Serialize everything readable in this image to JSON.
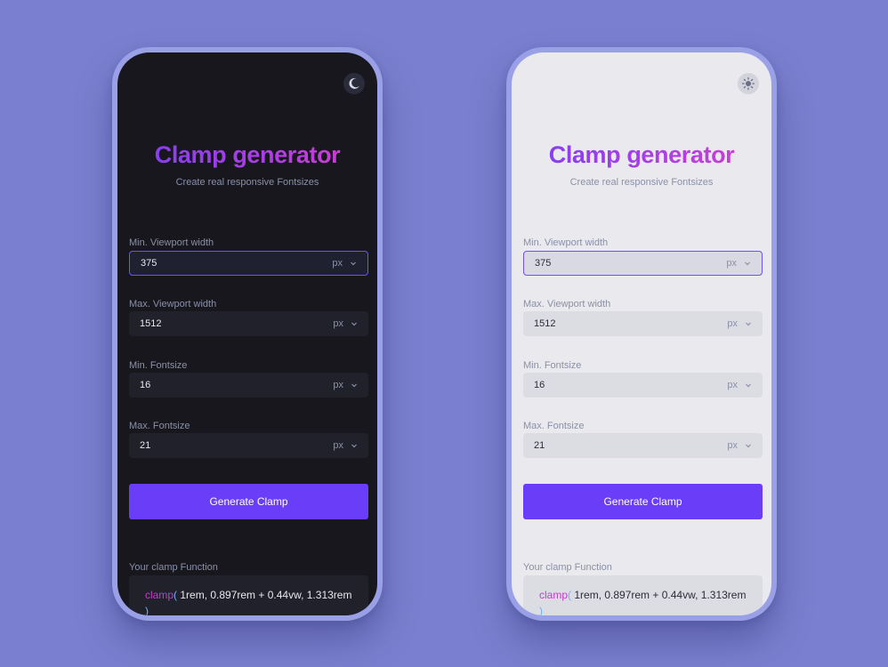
{
  "colors": {
    "background": "#7a7fcf",
    "accent": "#6a3df8",
    "title_gradient_start": "#7b3ff2",
    "title_gradient_end": "#d53ec9",
    "function_keyword": "#c23ec7",
    "parenthesis": "#6fb0ff"
  },
  "dark": {
    "theme_icon": "moon-icon",
    "title": "Clamp generator",
    "subtitle": "Create real responsive Fontsizes",
    "fields": [
      {
        "label": "Min. Viewport width",
        "value": "375",
        "unit": "px"
      },
      {
        "label": "Max. Viewport width",
        "value": "1512",
        "unit": "px"
      },
      {
        "label": "Min. Fontsize",
        "value": "16",
        "unit": "px"
      },
      {
        "label": "Max. Fontsize",
        "value": "21",
        "unit": "px"
      }
    ],
    "generate_label": "Generate Clamp",
    "result_label": "Your clamp Function",
    "result": {
      "fn": "clamp",
      "open": "(",
      "args": " 1rem, 0.897rem + 0.44vw, 1.313rem ",
      "close": ")"
    }
  },
  "light": {
    "theme_icon": "sun-icon",
    "title": "Clamp generator",
    "subtitle": "Create real responsive Fontsizes",
    "fields": [
      {
        "label": "Min. Viewport width",
        "value": "375",
        "unit": "px"
      },
      {
        "label": "Max. Viewport width",
        "value": "1512",
        "unit": "px"
      },
      {
        "label": "Min. Fontsize",
        "value": "16",
        "unit": "px"
      },
      {
        "label": "Max. Fontsize",
        "value": "21",
        "unit": "px"
      }
    ],
    "generate_label": "Generate Clamp",
    "result_label": "Your clamp Function",
    "result": {
      "fn": "clamp",
      "open": "(",
      "args": " 1rem, 0.897rem + 0.44vw, 1.313rem ",
      "close": ")"
    }
  }
}
